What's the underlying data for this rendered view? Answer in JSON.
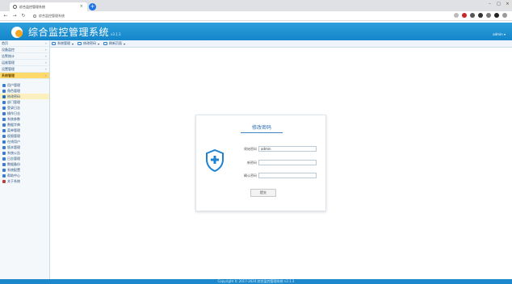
{
  "browser": {
    "tab_title": "综合监控管理系统",
    "url": "综合监控管理系统"
  },
  "app": {
    "name": "综合监控管理系统",
    "version": "v3.1.3",
    "user": "admin"
  },
  "sidebar": {
    "menu": [
      {
        "label": "首页"
      },
      {
        "label": "设备监控"
      },
      {
        "label": "告警统计"
      },
      {
        "label": "运维管理"
      },
      {
        "label": "设置管理"
      },
      {
        "label": "系统管理",
        "active": true
      }
    ],
    "sub_items": [
      {
        "label": "用户管理",
        "color": "#3a7bd5"
      },
      {
        "label": "角色管理",
        "color": "#3a7bd5"
      },
      {
        "label": "修改密码",
        "color": "#1f6fc5",
        "selected": true
      },
      {
        "label": "部门管理",
        "color": "#3a7bd5"
      },
      {
        "label": "登录日志",
        "color": "#3a7bd5"
      },
      {
        "label": "操作日志",
        "color": "#3a7bd5"
      },
      {
        "label": "系统参数",
        "color": "#3a7bd5"
      },
      {
        "label": "数据字典",
        "color": "#3a7bd5"
      },
      {
        "label": "菜单管理",
        "color": "#3a7bd5"
      },
      {
        "label": "权限管理",
        "color": "#3a7bd5"
      },
      {
        "label": "在线用户",
        "color": "#3a7bd5"
      },
      {
        "label": "版本管理",
        "color": "#3a7bd5"
      },
      {
        "label": "系统公告",
        "color": "#3a7bd5"
      },
      {
        "label": "日志管理",
        "color": "#3a7bd5"
      },
      {
        "label": "数据备份",
        "color": "#3a7bd5"
      },
      {
        "label": "系统配置",
        "color": "#3a7bd5"
      },
      {
        "label": "帮助中心",
        "color": "#3a7bd5"
      },
      {
        "label": "关于系统",
        "color": "#c23b3b"
      }
    ]
  },
  "toolbar": {
    "items": [
      {
        "label": "系统管理"
      },
      {
        "label": "修改密码"
      },
      {
        "label": "刷新页面"
      }
    ]
  },
  "card": {
    "title": "修改密码",
    "fields": [
      {
        "label": "原始密码",
        "value": "admin",
        "placeholder": ""
      },
      {
        "label": "新密码",
        "value": "",
        "placeholder": ""
      },
      {
        "label": "确认密码",
        "value": "",
        "placeholder": ""
      }
    ],
    "submit_label": "提交"
  },
  "footer": {
    "text": "Copyright © 2017-2024 综合监控管理系统 v3.1.3"
  }
}
